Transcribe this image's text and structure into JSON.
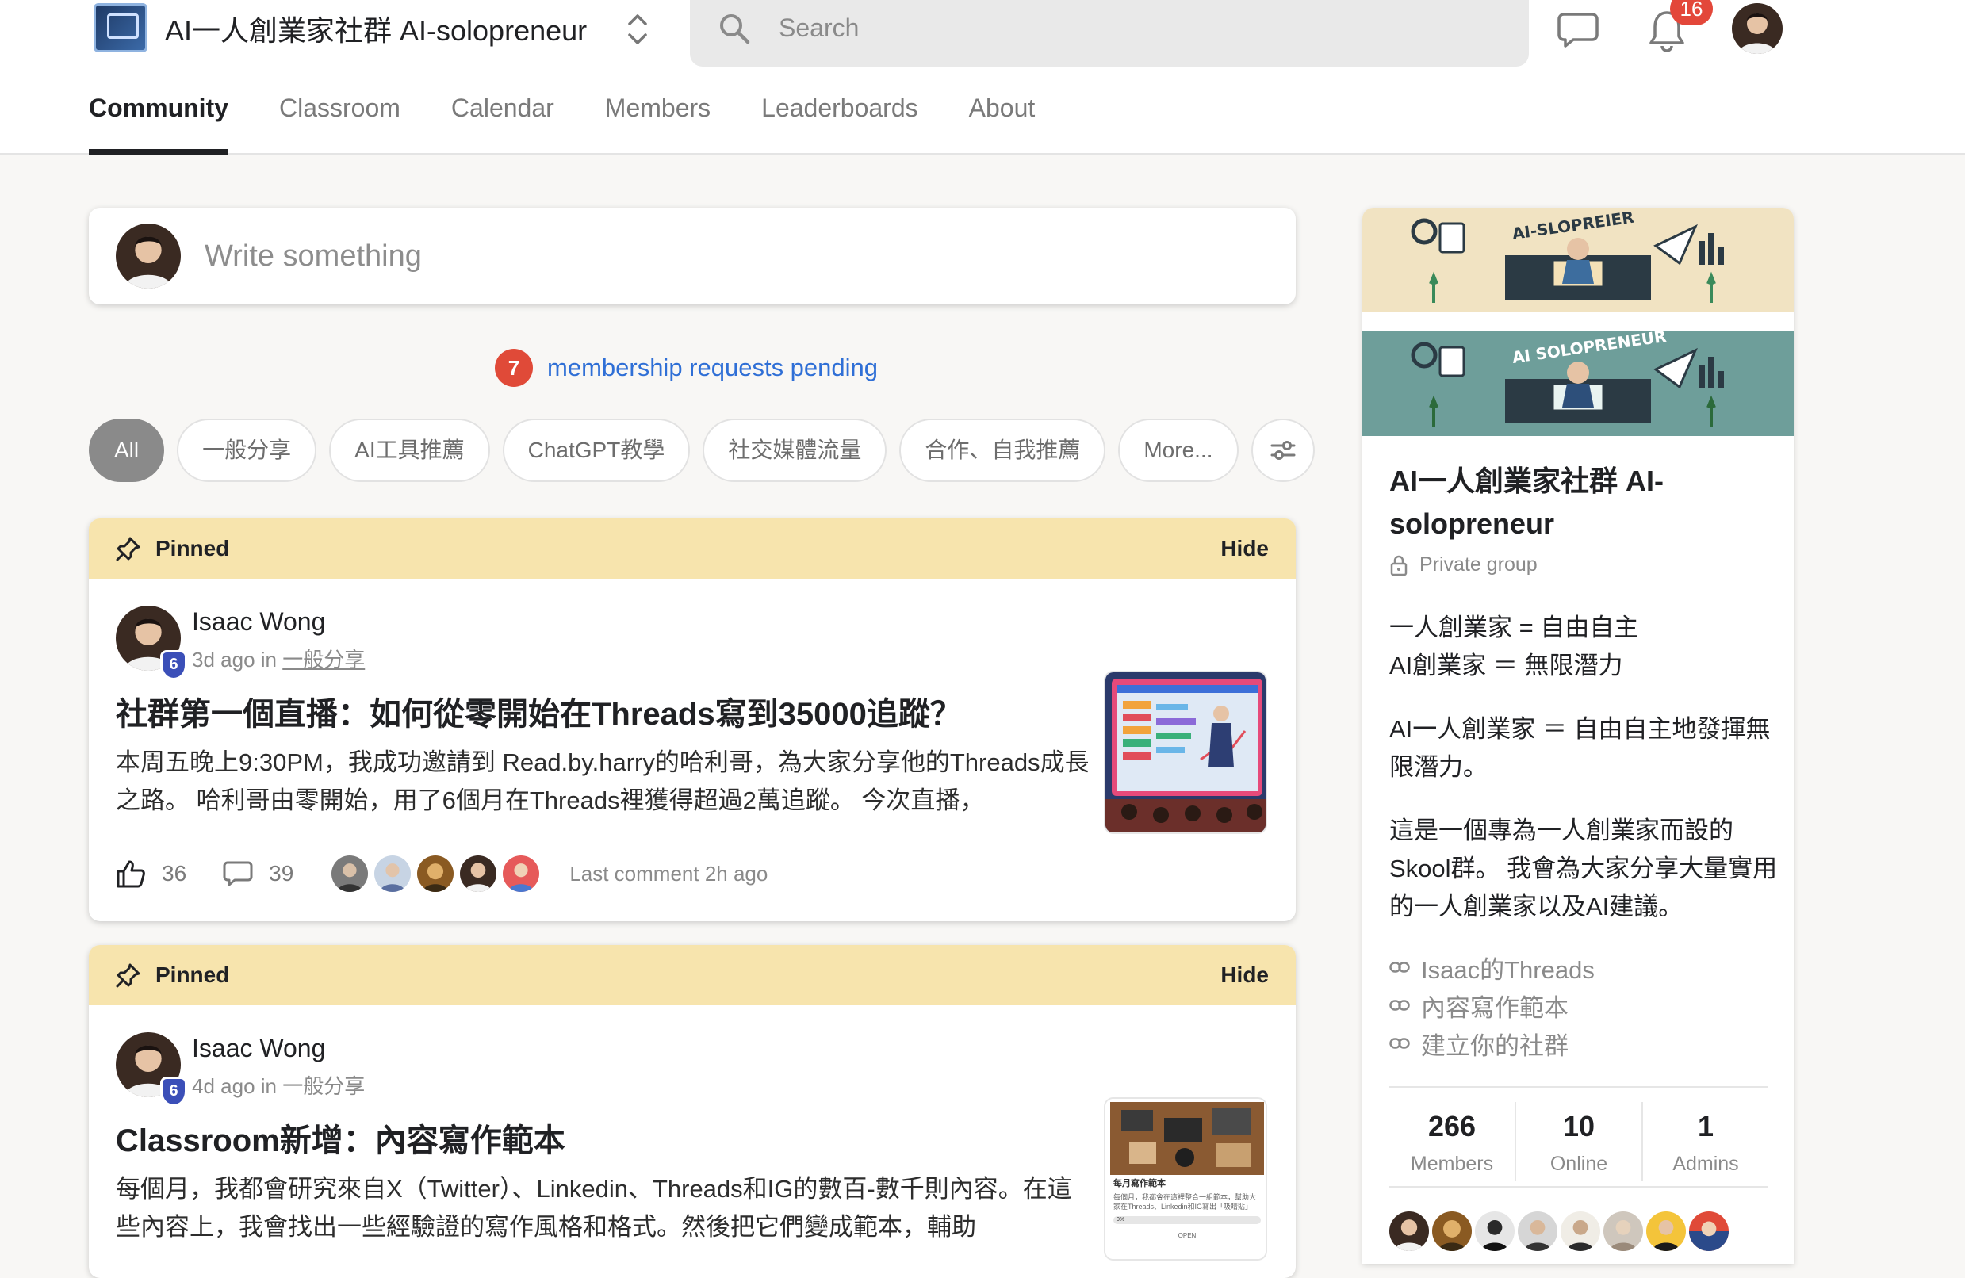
{
  "header": {
    "brand": "AI一人創業家社群 AI-solopreneur",
    "search_placeholder": "Search",
    "notification_count": "16"
  },
  "tabs": [
    {
      "label": "Community",
      "active": true
    },
    {
      "label": "Classroom",
      "active": false
    },
    {
      "label": "Calendar",
      "active": false
    },
    {
      "label": "Members",
      "active": false
    },
    {
      "label": "Leaderboards",
      "active": false
    },
    {
      "label": "About",
      "active": false
    }
  ],
  "composer": {
    "placeholder": "Write something"
  },
  "pending": {
    "count": "7",
    "text": "membership requests pending"
  },
  "categories": [
    "All",
    "一般分享",
    "AI工具推薦",
    "ChatGPT教學",
    "社交媒體流量",
    "合作、自我推薦",
    "More..."
  ],
  "posts": [
    {
      "pinned_label": "Pinned",
      "hide_label": "Hide",
      "author": "Isaac Wong",
      "level": "6",
      "time": "3d ago in",
      "category": "一般分享",
      "title": "社群第一個直播：如何從零開始在Threads寫到35000追蹤？",
      "body": "本周五晚上9:30PM，我成功邀請到 Read.by.harry的哈利哥，為大家分享他的Threads成長之路。 哈利哥由零開始，用了6個月在Threads裡獲得超過2萬追蹤。 今次直播，",
      "likes": "36",
      "comments": "39",
      "last_comment": "Last comment 2h ago"
    },
    {
      "pinned_label": "Pinned",
      "hide_label": "Hide",
      "author": "Isaac Wong",
      "level": "6",
      "time": "4d ago in",
      "category": "一般分享",
      "title": "Classroom新增：內容寫作範本",
      "body": "每個月，我都會研究來自X（Twitter）、Linkedin、Threads和IG的數百-數千則內容。在這些內容上，我會找出一些經驗證的寫作風格和格式。然後把它們變成範本，輔助"
    }
  ],
  "thumbnail2": {
    "heading": "每月寫作範本",
    "caption": "每個月，我都會在這裡整合一組範本，幫助大家在Threads、Linkedin和IG寫出「吸睛貼」",
    "progress": "0%",
    "status": "OPEN"
  },
  "group": {
    "title": "AI一人創業家社群 AI-solopreneur",
    "privacy": "Private group",
    "banner_text": [
      "AI-SLOPREIER",
      "AI SOLOPRENEUR"
    ],
    "desc": [
      [
        "一人創業家 = 自由自主",
        "AI創業家 ＝ 無限潛力"
      ],
      [
        "AI一人創業家 ＝ 自由自主地發揮無限潛力。"
      ],
      [
        "這是一個專為一人創業家而設的Skool群。 我會為大家分享大量實用的一人創業家以及AI建議。"
      ]
    ],
    "links": [
      "Isaac的Threads",
      "內容寫作範本",
      "建立你的社群"
    ],
    "stats": [
      {
        "value": "266",
        "label": "Members"
      },
      {
        "value": "10",
        "label": "Online"
      },
      {
        "value": "1",
        "label": "Admins"
      }
    ]
  },
  "colors": {
    "accent_link": "#2f6fd6",
    "badge_red": "#e04a38",
    "pinned_bar": "#f7e4ad",
    "level_badge": "#3b4fb8"
  }
}
